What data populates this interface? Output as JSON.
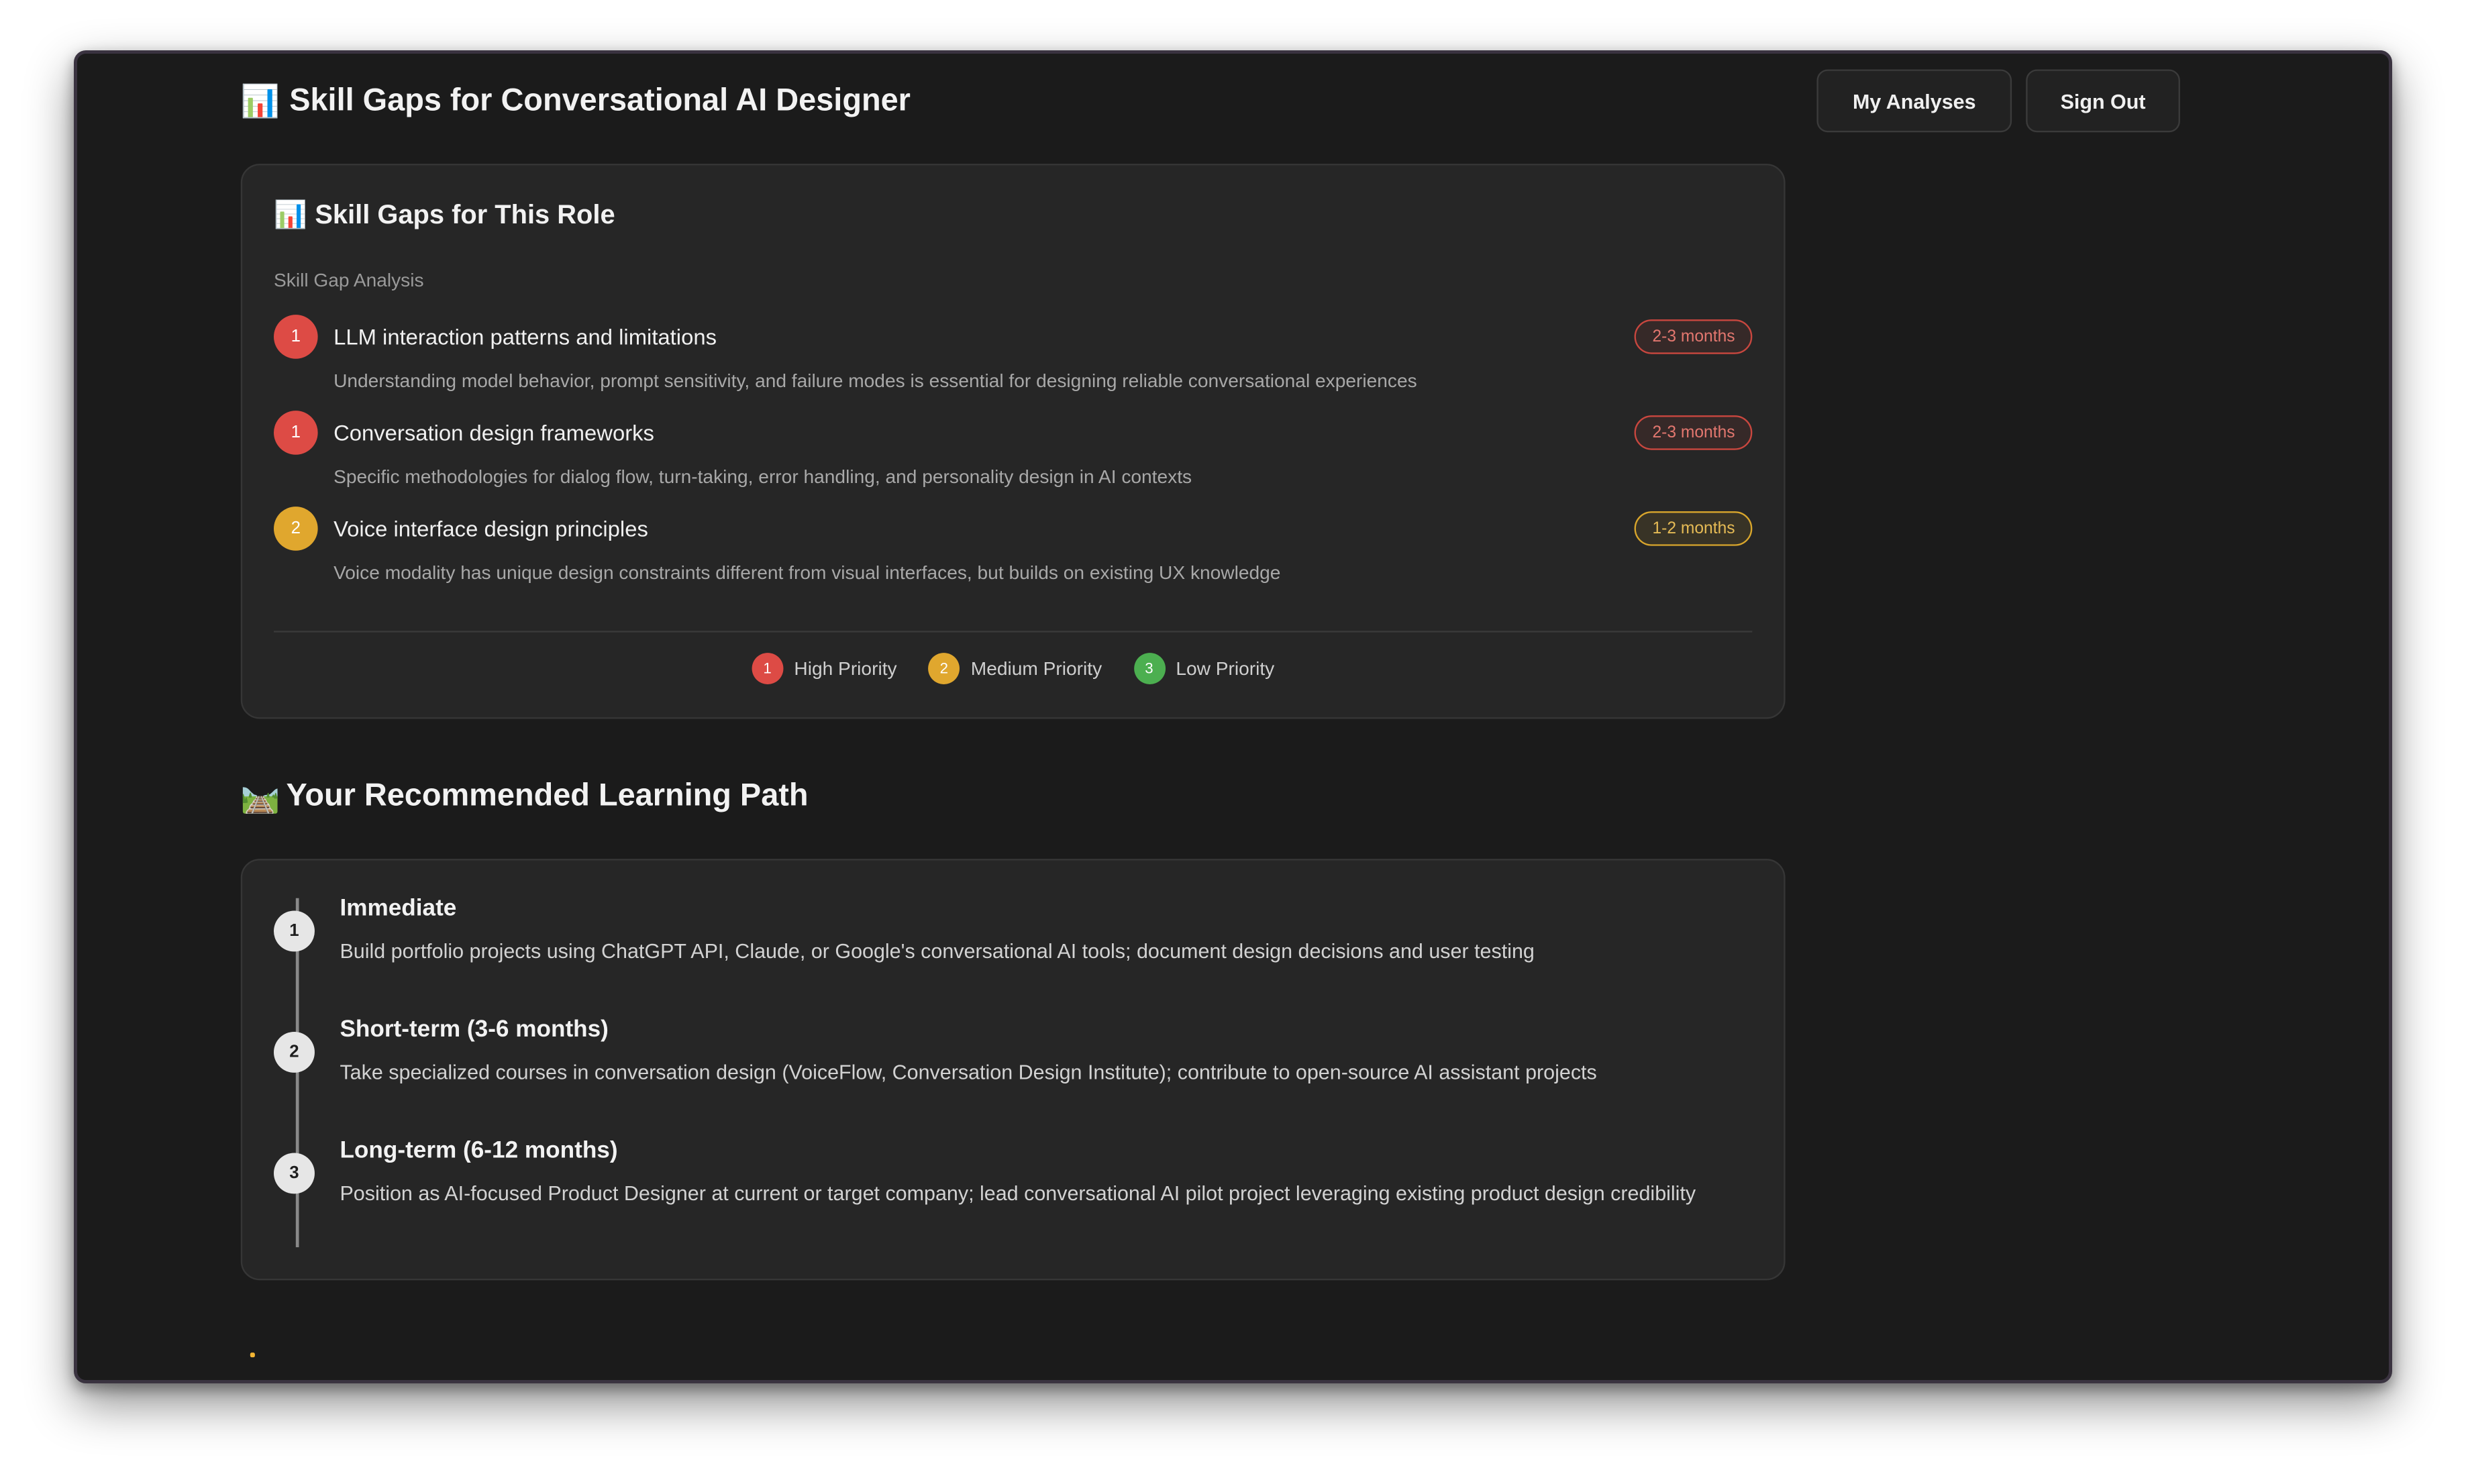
{
  "header": {
    "title_icon": "📊",
    "title": "Skill Gaps for Conversational AI Designer",
    "my_analyses_label": "My Analyses",
    "sign_out_label": "Sign Out"
  },
  "skill_gaps_card": {
    "title_icon": "📊",
    "title": "Skill Gaps for This Role",
    "section_label": "Skill Gap Analysis",
    "items": [
      {
        "priority": "1",
        "priority_level": "high",
        "name": "LLM interaction patterns and limitations",
        "description": "Understanding model behavior, prompt sensitivity, and failure modes is essential for designing reliable conversational experiences",
        "duration": "2-3 months"
      },
      {
        "priority": "1",
        "priority_level": "high",
        "name": "Conversation design frameworks",
        "description": "Specific methodologies for dialog flow, turn-taking, error handling, and personality design in AI contexts",
        "duration": "2-3 months"
      },
      {
        "priority": "2",
        "priority_level": "medium",
        "name": "Voice interface design principles",
        "description": "Voice modality has unique design constraints different from visual interfaces, but builds on existing UX knowledge",
        "duration": "1-2 months"
      }
    ],
    "legend": [
      {
        "number": "1",
        "label": "High Priority"
      },
      {
        "number": "2",
        "label": "Medium Priority"
      },
      {
        "number": "3",
        "label": "Low Priority"
      }
    ]
  },
  "learning_path": {
    "heading_icon": "🛤️",
    "heading": "Your Recommended Learning Path",
    "steps": [
      {
        "number": "1",
        "title": "Immediate",
        "description": "Build portfolio projects using ChatGPT API, Claude, or Google's conversational AI tools; document design decisions and user testing"
      },
      {
        "number": "2",
        "title": "Short-term (3-6 months)",
        "description": "Take specialized courses in conversation design (VoiceFlow, Conversation Design Institute); contribute to open-source AI assistant projects"
      },
      {
        "number": "3",
        "title": "Long-term (6-12 months)",
        "description": "Position as AI-focused Product Designer at current or target company; lead conversational AI pilot project leveraging existing product design credibility"
      }
    ]
  },
  "colors": {
    "high_priority": "#dd4b45",
    "medium_priority": "#e0a72e",
    "low_priority": "#4caf50",
    "background": "#1b1b1b",
    "card_background": "#262626"
  }
}
